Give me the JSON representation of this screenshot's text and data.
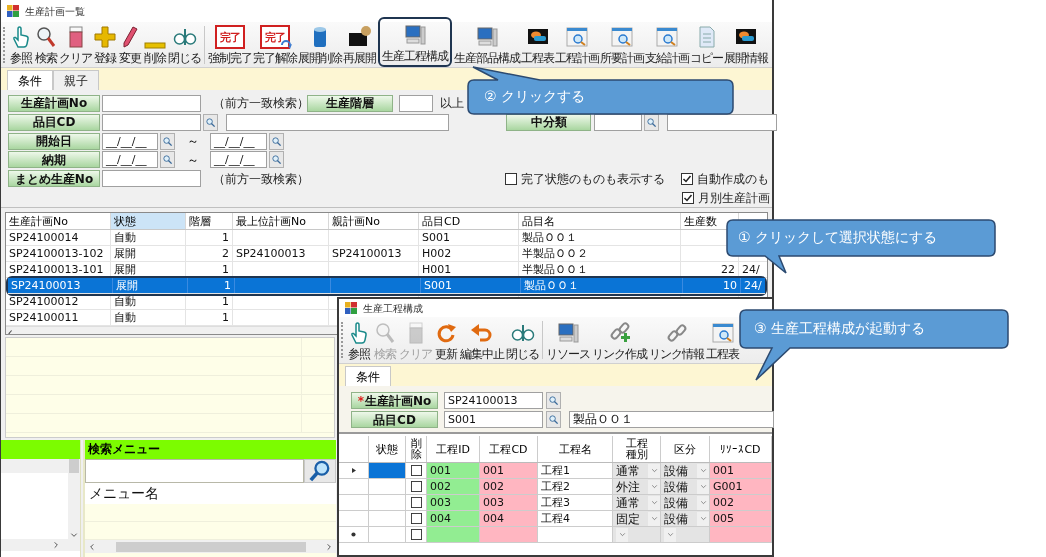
{
  "main_window": {
    "title": "生産計画一覧",
    "toolbar": [
      {
        "label": "参照"
      },
      {
        "label": "検索"
      },
      {
        "label": "クリア"
      },
      {
        "label": "登録"
      },
      {
        "label": "変更"
      },
      {
        "label": "削除"
      },
      {
        "label": "閉じる"
      },
      {
        "label": "強制完了",
        "icon_text": "完了"
      },
      {
        "label": "完了解除",
        "icon_text": "完了"
      },
      {
        "label": "展開削除"
      },
      {
        "label": "再展開"
      },
      {
        "label": "生産工程構成"
      },
      {
        "label": "生産部品構成"
      },
      {
        "label": "工程表"
      },
      {
        "label": "工程計画"
      },
      {
        "label": "所要計画"
      },
      {
        "label": "支給計画"
      },
      {
        "label": "コピー"
      },
      {
        "label": "展開情報"
      }
    ],
    "tabs": [
      {
        "label": "条件",
        "selected": true
      },
      {
        "label": "親子",
        "selected": false
      }
    ],
    "form": {
      "plan_no": {
        "label": "生産計画No",
        "note": "（前方一致検索）"
      },
      "plan_level": {
        "label": "生産階層",
        "suffix": "以上"
      },
      "item_cd": {
        "label": "品目CD"
      },
      "middle_class": {
        "label": "中分類"
      },
      "start_date": {
        "label": "開始日",
        "from": "__/__/__",
        "separator": "～",
        "to": "__/__/__"
      },
      "due_date": {
        "label": "納期",
        "from": "__/__/__",
        "separator": "～",
        "to": "__/__/__"
      },
      "batch_no": {
        "label": "まとめ生産No",
        "note": "（前方一致検索）"
      },
      "checkboxes": [
        {
          "label": "完了状態のものも表示する",
          "checked": false
        },
        {
          "label": "自動作成のも",
          "checked": true
        },
        {
          "label": "月別生産計画",
          "checked": true
        }
      ]
    },
    "grid": {
      "columns": [
        {
          "label": "生産計画No",
          "selected": false
        },
        {
          "label": "状態",
          "selected": true
        },
        {
          "label": "階層",
          "selected": false
        },
        {
          "label": "最上位計画No",
          "selected": false
        },
        {
          "label": "親計画No",
          "selected": false
        },
        {
          "label": "品目CD",
          "selected": false
        },
        {
          "label": "品目名",
          "selected": false
        },
        {
          "label": "生産数",
          "selected": false
        }
      ],
      "rows": [
        {
          "selected": false,
          "plan_no": "SP24100014",
          "status": "自動",
          "tier": "1",
          "item_cd": "S001",
          "item_name": "製品ＯＯ１"
        },
        {
          "selected": false,
          "plan_no": "SP24100013-102",
          "status": "展開",
          "tier": "2",
          "top_plan_no": "SP24100013",
          "parent_plan_no": "SP24100013",
          "item_cd": "H002",
          "item_name": "半製品ＯＯ２"
        },
        {
          "selected": false,
          "plan_no": "SP24100013-101",
          "status": "展開",
          "tier": "1",
          "item_cd": "H001",
          "item_name": "半製品ＯＯ１",
          "quantity": "22",
          "column_9": "24/"
        },
        {
          "selected": true,
          "plan_no": "SP24100013",
          "status": "展開",
          "tier": "1",
          "item_cd": "S001",
          "item_name": "製品ＯＯ１",
          "quantity": "10",
          "column_9": "24/"
        },
        {
          "selected": false,
          "plan_no": "SP24100012",
          "status": "自動",
          "tier": "1"
        },
        {
          "selected": false,
          "plan_no": "SP24100011",
          "status": "自動",
          "tier": "1"
        }
      ]
    },
    "search_menu": {
      "title": "検索メニュー",
      "list_header": "メニュー名"
    }
  },
  "child_window": {
    "title": "生産工程構成",
    "toolbar": [
      {
        "label": "参照",
        "disabled": false
      },
      {
        "label": "検索",
        "disabled": true
      },
      {
        "label": "クリア",
        "disabled": true
      },
      {
        "label": "更新",
        "disabled": false
      },
      {
        "label": "編集中止",
        "disabled": false
      },
      {
        "label": "閉じる",
        "disabled": false
      },
      {
        "label": "リソース",
        "disabled": false
      },
      {
        "label": "リンク作成",
        "disabled": false
      },
      {
        "label": "リンク情報",
        "disabled": false
      },
      {
        "label": "工程表",
        "disabled": false
      }
    ],
    "tabs": [
      {
        "label": "条件",
        "selected": true
      }
    ],
    "form": {
      "plan_no": {
        "required_mark": "*",
        "label": "生産計画No",
        "value": "SP24100013"
      },
      "item_cd": {
        "label": "品目CD",
        "value": "S001",
        "name": "製品ＯＯ１"
      }
    },
    "grid": {
      "columns": [
        "状態",
        "削除",
        "工程ID",
        "工程CD",
        "工程名",
        "工程種別",
        "区分",
        "ﾘｿｰｽCD"
      ],
      "rows": [
        {
          "kind": "data",
          "current": true,
          "selected": true,
          "delete": false,
          "process_id": "001",
          "process_cd": "001",
          "process_name": "工程1",
          "process_type": "通常",
          "category": "設備",
          "resource_cd": "001"
        },
        {
          "kind": "data",
          "current": false,
          "selected": false,
          "delete": false,
          "process_id": "002",
          "process_cd": "002",
          "process_name": "工程2",
          "process_type": "外注",
          "category": "設備",
          "resource_cd": "G001"
        },
        {
          "kind": "data",
          "current": false,
          "selected": false,
          "delete": false,
          "process_id": "003",
          "process_cd": "003",
          "process_name": "工程3",
          "process_type": "通常",
          "category": "設備",
          "resource_cd": "002"
        },
        {
          "kind": "data",
          "current": false,
          "selected": false,
          "delete": false,
          "process_id": "004",
          "process_cd": "004",
          "process_name": "工程4",
          "process_type": "固定",
          "category": "設備",
          "resource_cd": "005"
        },
        {
          "kind": "new",
          "current": false,
          "selected": false,
          "delete": false
        }
      ]
    }
  },
  "callouts": [
    {
      "text": "② クリックする"
    },
    {
      "text": "① クリックして選択状態にする"
    },
    {
      "text": "③ 生産工程構成が起動する"
    }
  ]
}
